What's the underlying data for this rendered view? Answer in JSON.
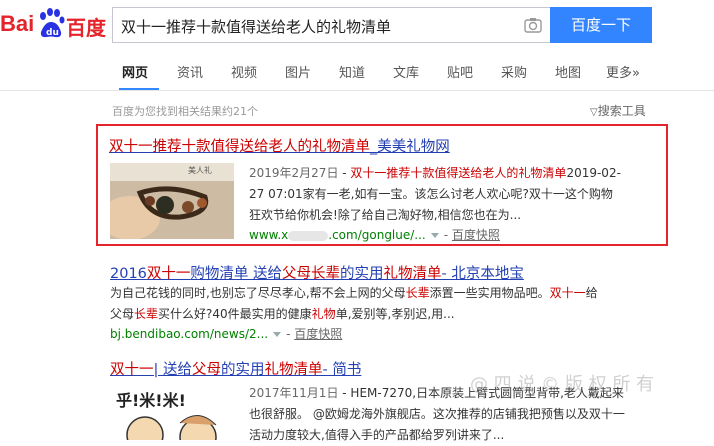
{
  "brand": {
    "logo_left": "Bai",
    "logo_right": "百度",
    "colors": {
      "red": "#e4232a",
      "blue": "#2932e1",
      "accent": "#3385ff",
      "link": "#2440b3",
      "url_green": "#008000"
    }
  },
  "search": {
    "query": "双十一推荐十款值得送给老人的礼物清单",
    "button": "百度一下",
    "camera_icon": "camera-icon"
  },
  "tabs": [
    "网页",
    "资讯",
    "视频",
    "图片",
    "知道",
    "文库",
    "贴吧",
    "采购",
    "地图",
    "更多»"
  ],
  "active_tab": "网页",
  "result_count": "百度为您找到相关结果约21个",
  "search_tools": "搜索工具",
  "results": [
    {
      "title": [
        "双十一推荐十款值得送给老人的礼物清单",
        "_美美礼物网"
      ],
      "date": "2019年2月27日",
      "snippet_1_mid": "双十一推荐十款值得送给老人的礼物清单",
      "snippet_1_end": "2019-02-",
      "snippet_2": "27 07:01家有一老,如有一宝。该怎么讨老人欢心呢?双十一这个购物",
      "snippet_3": "狂欢节给你机会!除了给自己淘好物,相信您也在为...",
      "url": "www.x",
      "url_tail": ".com/gonglue/...",
      "snapshot": "百度快照",
      "thumb_text": "美人礼"
    },
    {
      "title": [
        "2016",
        "双十一",
        "购物清单 送给",
        "父母长辈",
        "的实用",
        "礼物清单",
        "- 北京本地宝"
      ],
      "snippet_1": [
        "为自己花钱的同时,也别忘了尽尽孝心,帮不会上网的父母",
        "长辈",
        "添置一些实用物品吧。",
        "双十一",
        "给"
      ],
      "snippet_2": [
        "父母",
        "长辈",
        "买什么好?40件最实用的健康",
        "礼物",
        "单,爱别等,孝别迟,用..."
      ],
      "url": "bj.bendibao.com/news/2...",
      "snapshot": "百度快照"
    },
    {
      "title": [
        "双十一",
        "| 送给",
        "父母",
        "的实用",
        "礼物清单",
        "- 简书"
      ],
      "date": "2017年11月1日",
      "snippet_1": "HEM-7270,日本原装上臂式圆筒型背带,老人戴起来",
      "snippet_2": "也很舒服。 @欧姆龙海外旗舰店。这次推荐的店铺我把预售以及双十一",
      "snippet_3": "活动力度较大,值得入手的产品都给罗列讲来了...",
      "thumb_text": "乎!米!米!"
    }
  ],
  "watermark": "@ 四 说 © 版 权 所 有"
}
